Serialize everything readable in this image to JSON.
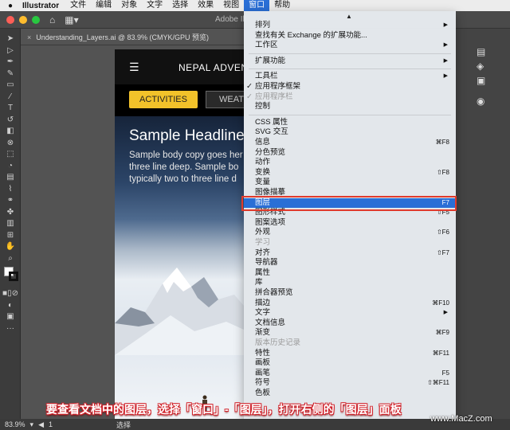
{
  "menubar": {
    "app": "Illustrator",
    "items": [
      "文件",
      "编辑",
      "对象",
      "文字",
      "选择",
      "效果",
      "视图",
      "窗口",
      "帮助"
    ]
  },
  "titlebar": {
    "title": "Adobe Ill"
  },
  "document_tab": {
    "label": "Understanding_Layers.ai @ 83.9% (CMYK/GPU 预览)"
  },
  "artboard": {
    "logo": "NEPAL ADVEN",
    "button_primary": "ACTIVITIES",
    "button_secondary": "WEAT",
    "headline": "Sample Headline",
    "body_line1": "Sample body copy goes her",
    "body_line2": "three line deep. Sample bo",
    "body_line3": "typically two to three line d"
  },
  "window_menu": {
    "items": [
      {
        "label": "排列",
        "submenu": true
      },
      {
        "label": "查找有关 Exchange 的扩展功能..."
      },
      {
        "label": "工作区",
        "submenu": true
      },
      {
        "label": "扩展功能",
        "submenu": true
      },
      {
        "label": "工具栏",
        "submenu": true
      },
      {
        "label": "应用程序框架",
        "checked": true
      },
      {
        "label": "应用程序栏",
        "checked": true,
        "disabled": true
      },
      {
        "label": "控制"
      },
      {
        "label": "CSS 属性"
      },
      {
        "label": "SVG 交互"
      },
      {
        "label": "信息",
        "shortcut": "⌘F8"
      },
      {
        "label": "分色预览"
      },
      {
        "label": "动作"
      },
      {
        "label": "变换",
        "shortcut": "⇧F8"
      },
      {
        "label": "变量"
      },
      {
        "label": "图像描摹"
      },
      {
        "label": "图层",
        "shortcut": "F7",
        "highlighted": true
      },
      {
        "label": "图形样式",
        "shortcut": "⇧F5"
      },
      {
        "label": "图案选项"
      },
      {
        "label": "外观",
        "shortcut": "⇧F6"
      },
      {
        "label": "学习",
        "disabled": true
      },
      {
        "label": "对齐",
        "shortcut": "⇧F7"
      },
      {
        "label": "导航器"
      },
      {
        "label": "属性"
      },
      {
        "label": "库"
      },
      {
        "label": "拼合器预览"
      },
      {
        "label": "描边",
        "shortcut": "⌘F10"
      },
      {
        "label": "文字",
        "submenu": true
      },
      {
        "label": "文档信息"
      },
      {
        "label": "渐变",
        "shortcut": "⌘F9"
      },
      {
        "label": "版本历史记录",
        "disabled": true
      },
      {
        "label": "特性",
        "shortcut": "⌘F11"
      },
      {
        "label": "画板"
      },
      {
        "label": "画笔",
        "shortcut": "F5"
      },
      {
        "label": "符号",
        "shortcut": "⇧⌘F11"
      },
      {
        "label": "色板"
      }
    ]
  },
  "statusbar": {
    "zoom": "83.9%",
    "page": "1",
    "mode": "选择"
  },
  "caption": "要查看文档中的图层，选择「窗口」-「图层」，打开右侧的「图层」面板",
  "watermark": "www.MacZ.com",
  "colors": {
    "highlight": "#2a6fd6",
    "callout": "#e03a2c",
    "accent": "#f2c22a"
  }
}
